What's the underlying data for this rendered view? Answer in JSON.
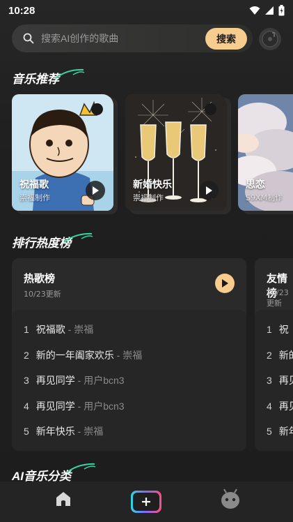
{
  "status_bar": {
    "time": "10:28"
  },
  "search": {
    "placeholder": "搜索AI创作的歌曲",
    "button_label": "搜索"
  },
  "sections": {
    "recommend": {
      "title": "音乐推荐"
    },
    "ranking": {
      "title": "排行热度榜"
    },
    "category": {
      "title": "AI音乐分类"
    }
  },
  "songs": [
    {
      "title": "祝福歌",
      "creator": "崇福制作"
    },
    {
      "title": "新婚快乐",
      "creator": "崇福制作"
    },
    {
      "title": "思恋",
      "creator": "S9XM制作"
    }
  ],
  "charts": [
    {
      "title": "热歌榜",
      "updated": "10/23更新",
      "items": [
        {
          "rank": "1",
          "song": "祝福歌",
          "artist": " - 崇福"
        },
        {
          "rank": "2",
          "song": "新的一年阖家欢乐",
          "artist": " - 崇福"
        },
        {
          "rank": "3",
          "song": "再见同学",
          "artist": " - 用户bcn3"
        },
        {
          "rank": "4",
          "song": "再见同学",
          "artist": " - 用户bcn3"
        },
        {
          "rank": "5",
          "song": "新年快乐",
          "artist": " - 崇福"
        }
      ]
    },
    {
      "title": "友情榜",
      "updated": "10/23更新",
      "items": [
        {
          "rank": "1",
          "song": "祝"
        },
        {
          "rank": "2",
          "song": "新的"
        },
        {
          "rank": "3",
          "song": "再见"
        },
        {
          "rank": "4",
          "song": "再见"
        },
        {
          "rank": "5",
          "song": "新年"
        }
      ]
    }
  ],
  "bottom_nav": [
    {
      "icon": "home-icon"
    },
    {
      "icon": "plus-icon"
    },
    {
      "icon": "robot-icon"
    }
  ],
  "colors": {
    "accent": "#f6cd8e",
    "background": "#1e1e1e",
    "panel": "#2a2a2a",
    "deco_green": "#35d6a4"
  }
}
